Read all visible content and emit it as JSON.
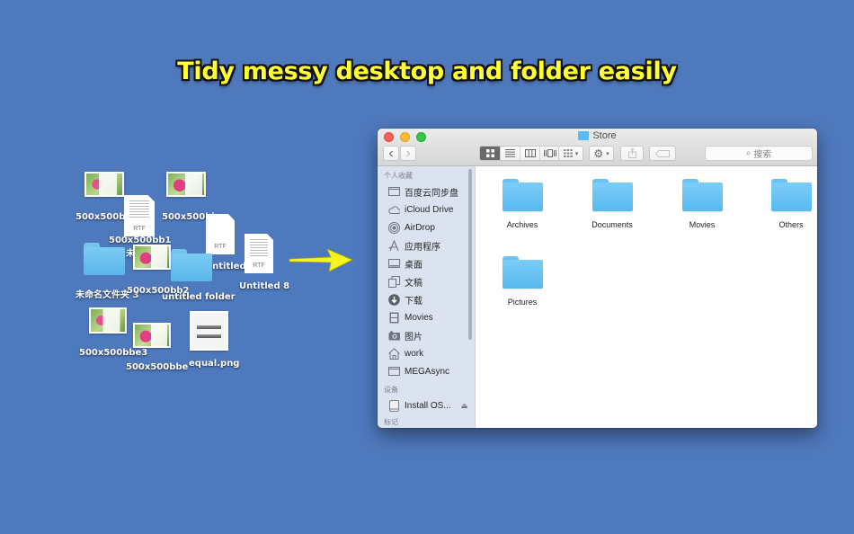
{
  "headline": "Tidy messy desktop and folder easily",
  "desktop": {
    "items": [
      {
        "label": "500x500bb",
        "type": "image"
      },
      {
        "label": "500x500bb",
        "type": "image"
      },
      {
        "label": "500x500bb1",
        "type": "rtf"
      },
      {
        "label": "未命名",
        "type": "image"
      },
      {
        "label": "Untitled",
        "type": "rtf"
      },
      {
        "label": "Untitled 8",
        "type": "rtf"
      },
      {
        "label": "未命名文件夹 3",
        "type": "folder"
      },
      {
        "label": "500x500bb2",
        "type": "image"
      },
      {
        "label": "untitled folder",
        "type": "folder"
      },
      {
        "label": "500x500bbe3",
        "type": "image"
      },
      {
        "label": "500x500bbe",
        "type": "image"
      },
      {
        "label": "equal.png",
        "type": "image"
      }
    ],
    "rtf_tag": "RTF"
  },
  "arrow_color": "#f5f51e",
  "finder": {
    "title": "Store",
    "toolbar": {
      "back": "‹",
      "forward": "›",
      "views": [
        "icon-view",
        "list-view",
        "column-view",
        "cover-flow-view"
      ],
      "arrange": "arrange-menu",
      "action": "action-menu",
      "share": "share",
      "tags": "tags",
      "search_placeholder": "搜索"
    },
    "sidebar": {
      "favorites_header": "个人收藏",
      "favorites": [
        {
          "label": "百度云同步盘",
          "icon": "folder-icon"
        },
        {
          "label": "iCloud Drive",
          "icon": "cloud-icon"
        },
        {
          "label": "AirDrop",
          "icon": "airdrop-icon"
        },
        {
          "label": "应用程序",
          "icon": "applications-icon"
        },
        {
          "label": "桌面",
          "icon": "desktop-icon"
        },
        {
          "label": "文稿",
          "icon": "documents-icon"
        },
        {
          "label": "下载",
          "icon": "downloads-icon"
        },
        {
          "label": "Movies",
          "icon": "movies-icon"
        },
        {
          "label": "图片",
          "icon": "camera-icon"
        },
        {
          "label": "work",
          "icon": "home-icon"
        },
        {
          "label": "MEGAsync",
          "icon": "folder-icon"
        }
      ],
      "devices_header": "设备",
      "devices": [
        {
          "label": "Install OS...",
          "icon": "disk-icon"
        }
      ],
      "tags_header": "标记"
    },
    "content": {
      "items": [
        "Archives",
        "Documents",
        "Movies",
        "Others",
        "Pictures"
      ]
    }
  },
  "colors": {
    "desktop_bg": "#4f79bd",
    "headline": "#ffff33",
    "folder": "#5ab6ea",
    "close": "#fc5f57",
    "minimize": "#fdbc2e",
    "zoom": "#33c748"
  }
}
